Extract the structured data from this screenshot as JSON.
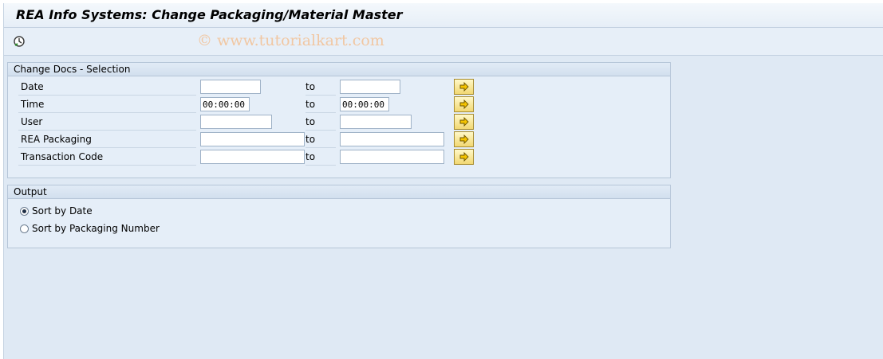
{
  "window": {
    "title": "REA Info Systems: Change Packaging/Material Master",
    "watermark": "© www.tutorialkart.com"
  },
  "toolbar": {
    "execute_icon": "execute-clock-icon"
  },
  "selection": {
    "header": "Change Docs - Selection",
    "to_label": "to",
    "rows": [
      {
        "label": "Date",
        "from": "",
        "to": ""
      },
      {
        "label": "Time",
        "from": "00:00:00",
        "to": "00:00:00"
      },
      {
        "label": "User",
        "from": "",
        "to": ""
      },
      {
        "label": "REA Packaging",
        "from": "",
        "to": ""
      },
      {
        "label": "Transaction Code",
        "from": "",
        "to": ""
      }
    ],
    "more_icon": "arrow-right-icon"
  },
  "output": {
    "header": "Output",
    "options": [
      {
        "label": "Sort by Date",
        "selected": true
      },
      {
        "label": "Sort by Packaging Number",
        "selected": false
      }
    ]
  }
}
